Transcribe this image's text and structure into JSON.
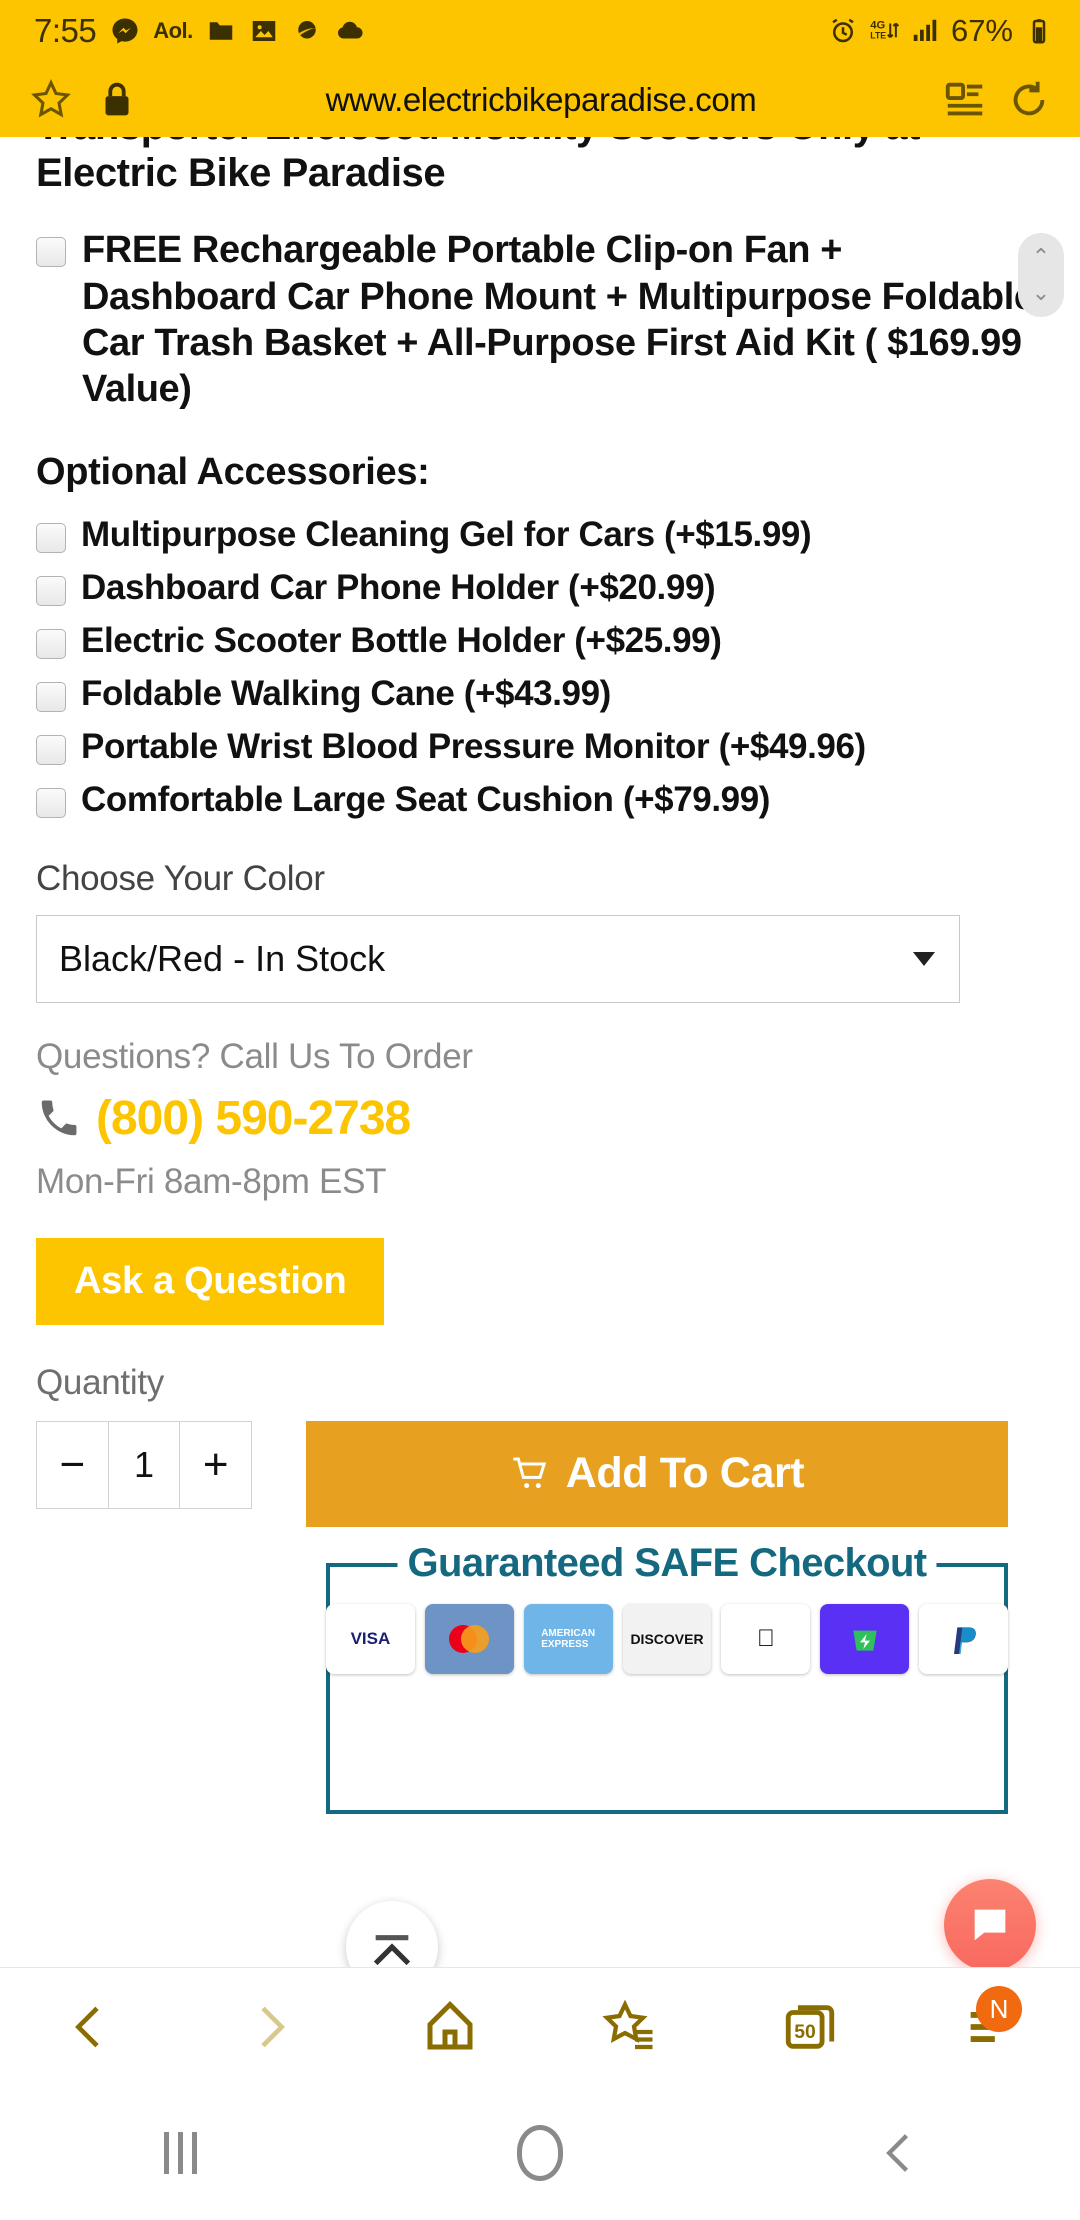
{
  "status_bar": {
    "time": "7:55",
    "icons": [
      "messenger-icon",
      "aol-icon",
      "folder-icon",
      "gallery-icon",
      "saturn-icon",
      "cloud-icon"
    ],
    "aol_label": "Aol.",
    "network": "4G LTE",
    "battery_percent": "67%",
    "right_icons": [
      "alarm-icon",
      "lte-icon",
      "signal-icon",
      "battery-icon"
    ]
  },
  "browser": {
    "url": "www.electricbikeparadise.com",
    "left_icons": [
      "star-bookmark-icon",
      "lock-icon"
    ],
    "right_icons": [
      "reader-view-icon",
      "refresh-icon"
    ],
    "bottom_nav": {
      "back_label": "Back",
      "forward_label": "Forward",
      "home_label": "Home",
      "bookmarks_label": "Bookmarks",
      "tabs_count": "50",
      "menu_badge": "N"
    }
  },
  "page": {
    "heading": "Transporter Enclosed Mobility Scooters Only at Electric Bike Paradise",
    "free_offer": "FREE Rechargeable Portable Clip-on Fan + Dashboard Car Phone Mount + Multipurpose Foldable Car Trash Basket + All-Purpose First Aid Kit ( $169.99 Value)",
    "accessories_heading": "Optional Accessories:",
    "accessories": [
      "Multipurpose Cleaning Gel for Cars (+$15.99)",
      "Dashboard Car Phone Holder (+$20.99)",
      "Electric Scooter Bottle Holder (+$25.99)",
      "Foldable Walking Cane (+$43.99)",
      "Portable Wrist Blood Pressure Monitor (+$49.96)",
      "Comfortable Large Seat Cushion (+$79.99)"
    ],
    "color": {
      "label": "Choose Your Color",
      "selected": "Black/Red - In Stock"
    },
    "contact": {
      "question_label": "Questions? Call Us To Order",
      "phone": "(800) 590-2738",
      "hours": "Mon-Fri 8am-8pm EST",
      "phone_color": "#FDC400"
    },
    "ask_button": "Ask a Question",
    "quantity": {
      "label": "Quantity",
      "minus": "−",
      "value": "1",
      "plus": "+"
    },
    "add_to_cart": "Add To Cart",
    "checkout": {
      "title": "Guaranteed SAFE Checkout",
      "cards": [
        "VISA",
        "mastercard",
        "AMERICAN EXPRESS",
        "DISCOVER",
        "Apple Pay",
        "shop Pay",
        "PayPal"
      ]
    },
    "scroll_widget": {
      "up": "⌃",
      "down": "⌄"
    },
    "fab": {
      "scroll_top": "scroll-to-top-icon",
      "chat": "chat-bubble-icon"
    }
  },
  "android_nav": {
    "recents": "recents-button",
    "home": "home-button",
    "back": "back-button"
  }
}
